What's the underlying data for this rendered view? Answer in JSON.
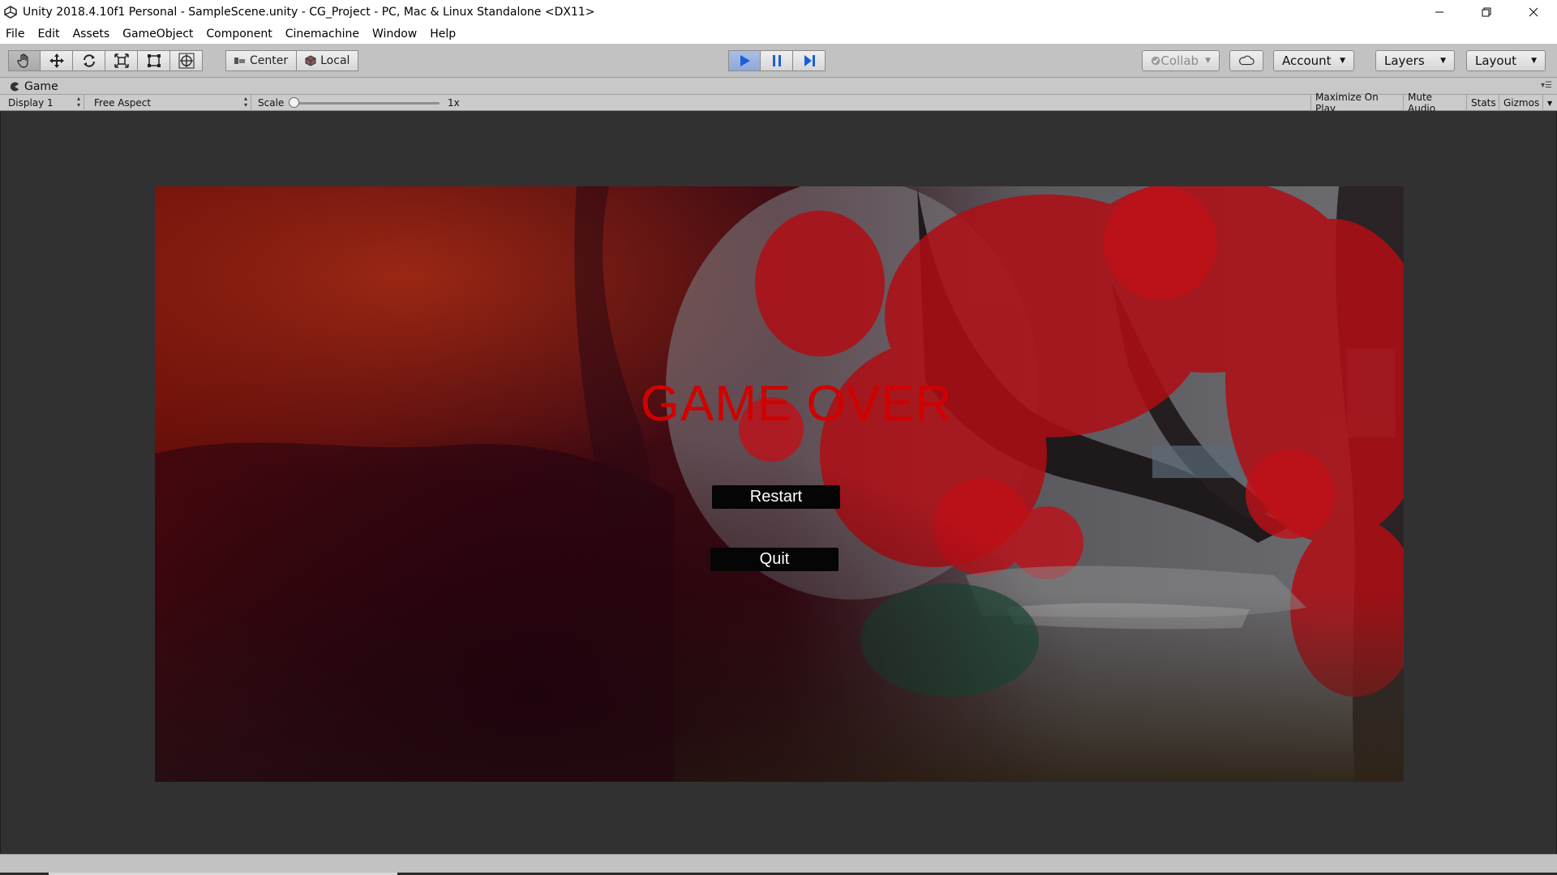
{
  "window": {
    "title": "Unity 2018.4.10f1 Personal - SampleScene.unity - CG_Project - PC, Mac & Linux Standalone <DX11>",
    "icon": "unity-logo-icon"
  },
  "menu": [
    "File",
    "Edit",
    "Assets",
    "GameObject",
    "Component",
    "Cinemachine",
    "Window",
    "Help"
  ],
  "toolbar": {
    "tools": [
      "hand-tool-icon",
      "move-tool-icon",
      "rotate-tool-icon",
      "scale-tool-icon",
      "rect-tool-icon",
      "transform-tool-icon"
    ],
    "pivot_mode": "Center",
    "pivot_rotation": "Local",
    "play_state": "playing",
    "collab": "Collab",
    "account": "Account",
    "layers": "Layers",
    "layout": "Layout"
  },
  "game_tab": {
    "label": "Game",
    "display": "Display 1",
    "aspect": "Free Aspect",
    "scale_label": "Scale",
    "scale_value": "1x",
    "scale_slider_level": 0.0,
    "maximize_on_play": "Maximize On Play",
    "mute_audio": "Mute Audio",
    "stats": "Stats",
    "gizmos": "Gizmos"
  },
  "game_ui": {
    "heading": "GAME OVER",
    "restart": "Restart",
    "quit": "Quit",
    "heading_color": "#d10000"
  },
  "colors": {
    "editor_bg": "#c2c2c2",
    "viewport_bg": "#313131",
    "play_active": "#8ea8d8"
  }
}
